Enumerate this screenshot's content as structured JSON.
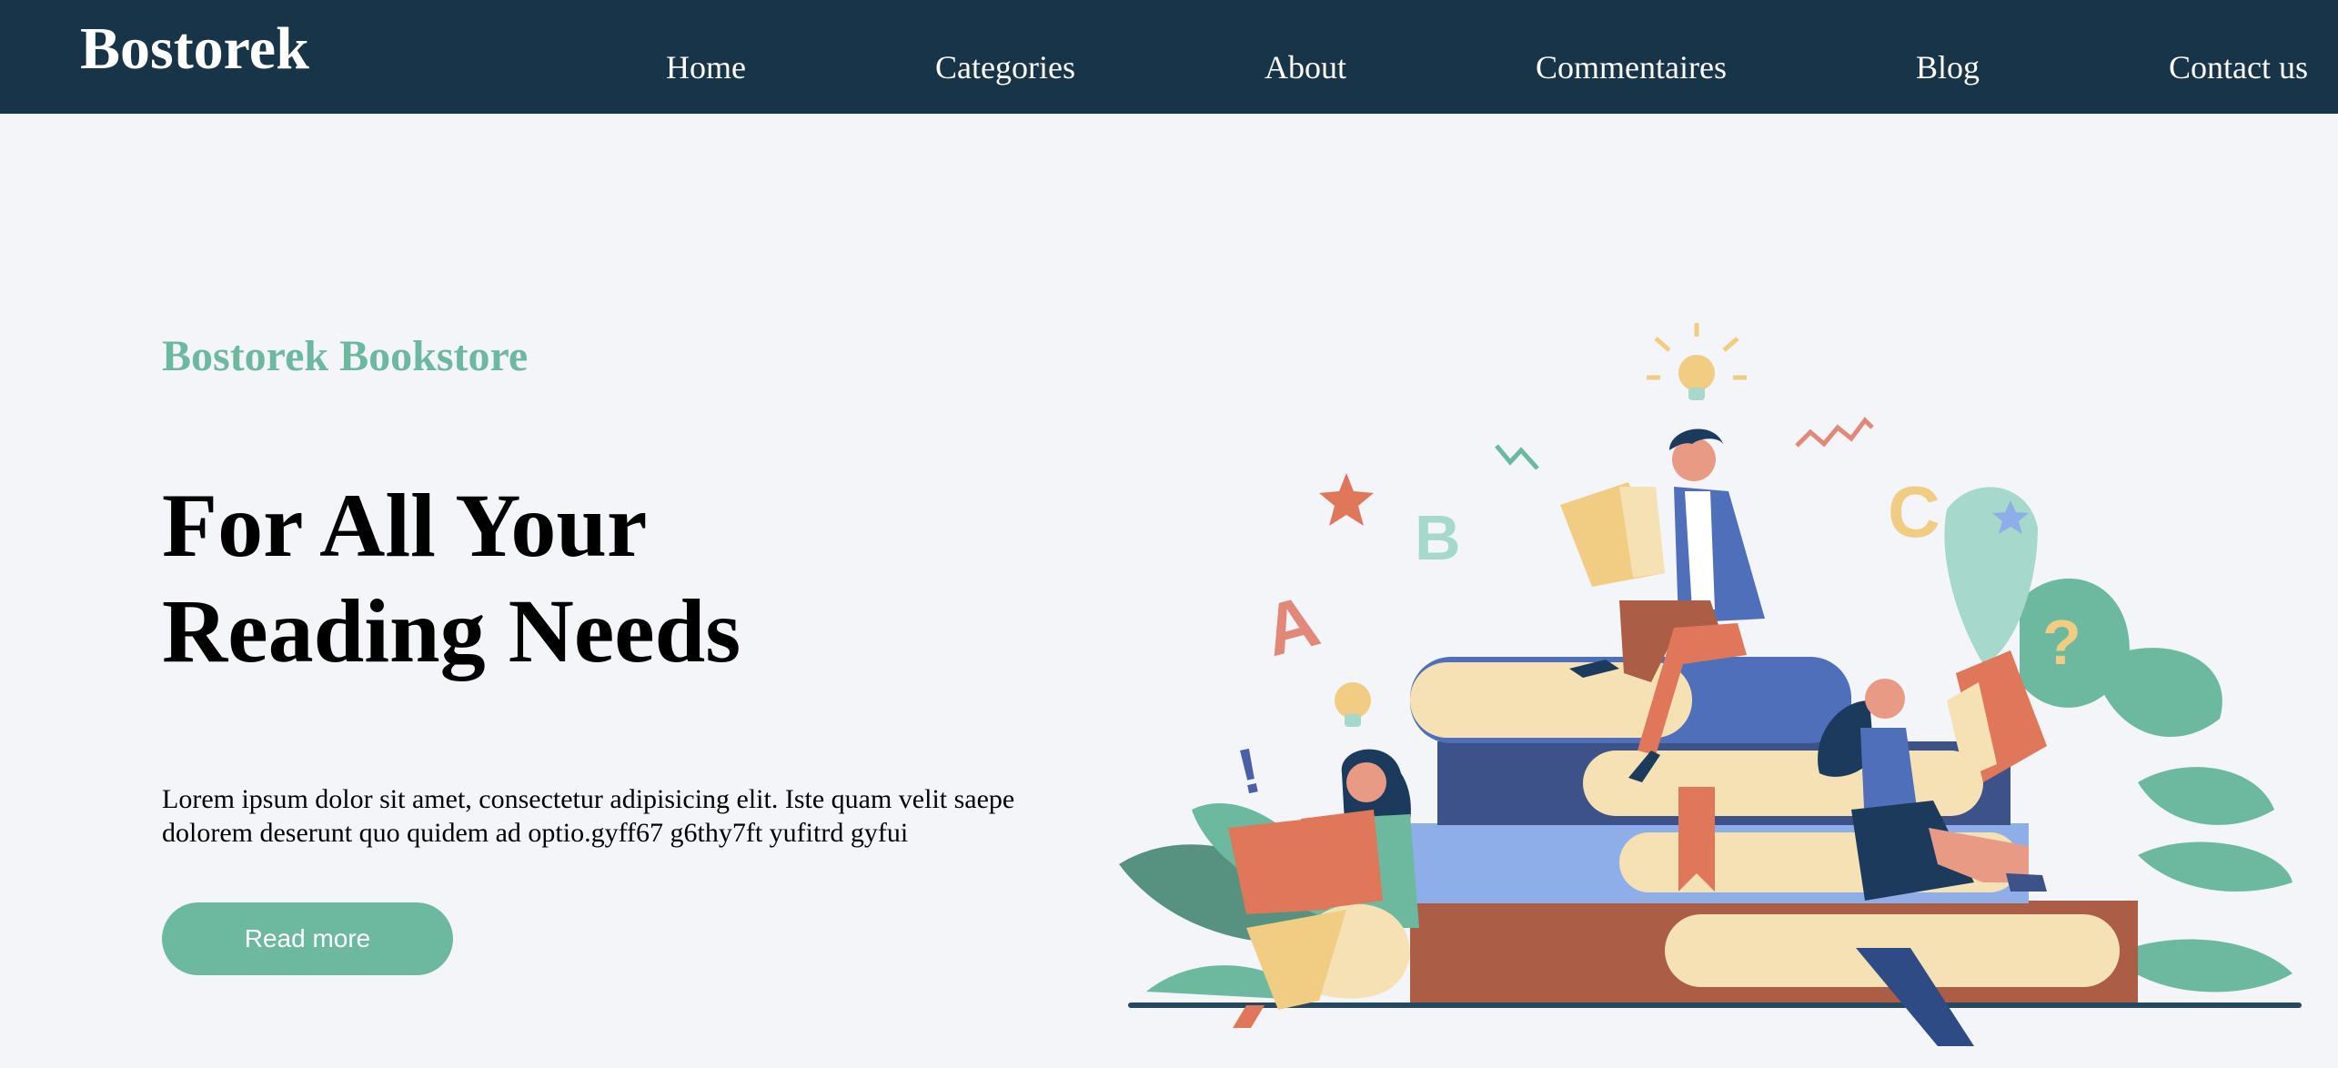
{
  "header": {
    "logo": "Bostorek",
    "nav": [
      "Home",
      "Categories",
      "About",
      "Commentaires",
      "Blog",
      "Contact us"
    ]
  },
  "hero": {
    "eyebrow": "Bostorek Bookstore",
    "title_line1": "For All Your",
    "title_line2": "Reading Needs",
    "text": "Lorem ipsum dolor sit amet, consectetur adipisicing elit. Iste quam velit saepe dolorem deserunt quo quidem ad optio.gyff67 g6thy7ft yufitrd gyfui",
    "button": "Read more"
  },
  "illustration": {
    "letters": [
      "A",
      "B",
      "C"
    ],
    "symbols": [
      "!",
      "?"
    ]
  },
  "colors": {
    "nav_bg": "#183448",
    "page_bg": "#f4f5f9",
    "accent": "#6cb9a0"
  }
}
